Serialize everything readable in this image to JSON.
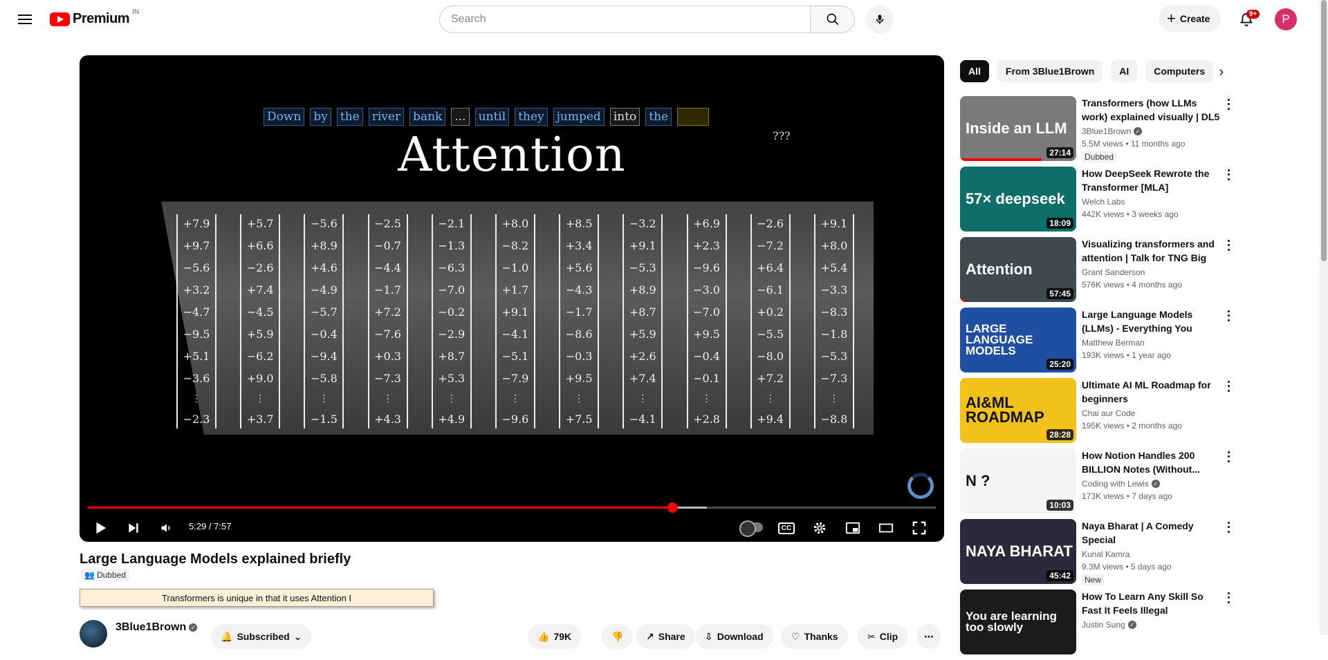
{
  "header": {
    "logo_text": "Premium",
    "region": "IN",
    "search_placeholder": "Search",
    "create_label": "Create",
    "notification_count": "9+",
    "avatar_letter": "P"
  },
  "player": {
    "overlay_title": "Attention",
    "tokens": [
      "Down",
      "by",
      "the",
      "river",
      "bank",
      "...",
      "until",
      "they",
      "jumped",
      "into",
      "the"
    ],
    "unknown_token": "???",
    "columns": [
      [
        "+7.9",
        "+9.7",
        "−5.6",
        "+3.2",
        "−4.7",
        "−9.5",
        "+5.1",
        "−3.6",
        "⋮",
        "−2.3"
      ],
      [
        "+5.7",
        "+6.6",
        "−2.6",
        "+7.4",
        "−4.5",
        "+5.9",
        "−6.2",
        "+9.0",
        "⋮",
        "+3.7"
      ],
      [
        "−5.6",
        "+8.9",
        "+4.6",
        "−4.9",
        "−5.7",
        "−0.4",
        "−9.4",
        "−5.8",
        "⋮",
        "−1.5"
      ],
      [
        "−2.5",
        "−0.7",
        "−4.4",
        "−1.7",
        "+7.2",
        "−7.6",
        "+0.3",
        "−7.3",
        "⋮",
        "+4.3"
      ],
      [
        "−2.1",
        "−1.3",
        "−6.3",
        "−7.0",
        "−0.2",
        "−2.9",
        "+8.7",
        "+5.3",
        "⋮",
        "+4.9"
      ],
      [
        "+8.0",
        "−8.2",
        "−1.0",
        "+1.7",
        "+9.1",
        "−4.1",
        "−5.1",
        "−7.9",
        "⋮",
        "−9.6"
      ],
      [
        "+8.5",
        "+3.4",
        "+5.6",
        "−4.3",
        "−1.7",
        "−8.6",
        "−0.3",
        "+9.5",
        "⋮",
        "+7.5"
      ],
      [
        "−3.2",
        "+9.1",
        "−5.3",
        "+8.9",
        "+8.7",
        "+5.9",
        "+2.6",
        "+7.4",
        "⋮",
        "−4.1"
      ],
      [
        "+6.9",
        "+2.3",
        "−9.6",
        "−3.0",
        "−7.0",
        "+9.5",
        "−0.4",
        "−0.1",
        "⋮",
        "+2.8"
      ],
      [
        "−2.6",
        "−7.2",
        "+6.4",
        "−6.1",
        "+0.2",
        "−5.5",
        "−8.0",
        "+7.2",
        "⋮",
        "+9.4"
      ],
      [
        "+9.1",
        "+8.0",
        "+5.4",
        "−3.3",
        "−8.3",
        "−1.8",
        "−5.3",
        "−7.3",
        "⋮",
        "−8.8"
      ]
    ],
    "time": "5:29 / 7:57",
    "progress_fraction": 0.689,
    "buffered_fraction": 0.73,
    "cc_label": "CC"
  },
  "video": {
    "title": "Large Language Models explained briefly",
    "dubbed": "Dubbed",
    "input_value": "Transformers is unique in that it uses Attention I",
    "channel": "3Blue1Brown",
    "subscribed": "Subscribed",
    "likes": "79K",
    "share": "Share",
    "download": "Download",
    "thanks": "Thanks",
    "clip": "Clip"
  },
  "chips": [
    "All",
    "From 3Blue1Brown",
    "AI",
    "Computers"
  ],
  "recommendations": [
    {
      "title": "Transformers (how LLMs work) explained visually | DL5",
      "channel": "3Blue1Brown",
      "verified": true,
      "stats": "5.5M views • 11 months ago",
      "badge": "Dubbed",
      "duration": "27:14",
      "watched": 0.7,
      "thumb_text": "Inside an LLM",
      "thumb_bg": "#7a7a7a"
    },
    {
      "title": "How DeepSeek Rewrote the Transformer [MLA]",
      "channel": "Welch Labs",
      "verified": false,
      "stats": "442K views • 3 weeks ago",
      "badge": "",
      "duration": "18:09",
      "watched": 0,
      "thumb_text": "57× deepseek",
      "thumb_bg": "#0e6e6a"
    },
    {
      "title": "Visualizing transformers and attention | Talk for TNG Big Te...",
      "channel": "Grant Sanderson",
      "verified": false,
      "stats": "576K views • 4 months ago",
      "badge": "",
      "duration": "57:45",
      "watched": 0.05,
      "thumb_text": "Attention",
      "thumb_bg": "#3f4a4e"
    },
    {
      "title": "Large Language Models (LLMs) - Everything You NEED To Know",
      "channel": "Matthew Berman",
      "verified": false,
      "stats": "193K views • 1 year ago",
      "badge": "",
      "duration": "25:20",
      "watched": 0,
      "thumb_text": "LARGE LANGUAGE MODELS",
      "thumb_bg": "#1e4fa0"
    },
    {
      "title": "Ultimate AI ML Roadmap for beginners",
      "channel": "Chai aur Code",
      "verified": false,
      "stats": "195K views • 2 months ago",
      "badge": "",
      "duration": "28:28",
      "watched": 0,
      "thumb_text": "AI&ML ROADMAP",
      "thumb_bg": "#f2c21a"
    },
    {
      "title": "How Notion Handles 200 BILLION Notes (Without...",
      "channel": "Coding with Lewis",
      "verified": true,
      "stats": "173K views • 7 days ago",
      "badge": "",
      "duration": "10:03",
      "watched": 0,
      "thumb_text": "N ?",
      "thumb_bg": "#f4f4f4"
    },
    {
      "title": "Naya Bharat | A Comedy Special",
      "channel": "Kunal Kamra",
      "verified": false,
      "stats": "9.3M views • 5 days ago",
      "badge": "New",
      "duration": "45:42",
      "watched": 0,
      "thumb_text": "NAYA BHARAT",
      "thumb_bg": "#2a2a3a"
    },
    {
      "title": "How To Learn Any Skill So Fast It Feels Illegal",
      "channel": "Justin Sung",
      "verified": true,
      "stats": "",
      "badge": "",
      "duration": "",
      "watched": 0,
      "thumb_text": "You are learning too slowly",
      "thumb_bg": "#1b1b1b"
    }
  ]
}
